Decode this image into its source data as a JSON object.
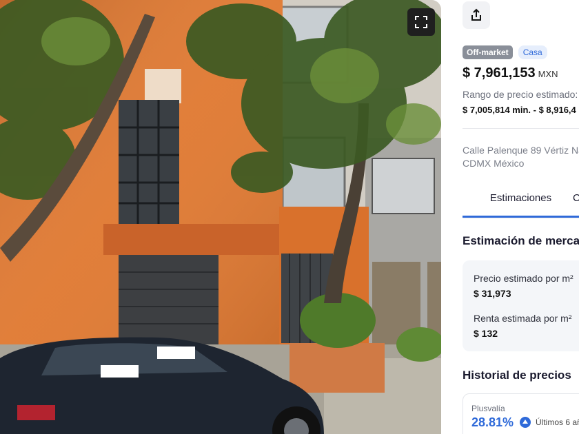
{
  "photo": {
    "alt_icons": [
      "expand-icon"
    ]
  },
  "listing": {
    "status_badge": "Off-market",
    "type_badge": "Casa",
    "price": "$ 7,961,153",
    "currency": "MXN",
    "range_label": "Rango de precio estimado:",
    "range_value": "$ 7,005,814 min. - $ 8,916,4",
    "address_line1": "Calle Palenque 89 Vértiz Na",
    "address_line2": "CDMX México"
  },
  "tabs": [
    {
      "label": "Estimaciones",
      "active": true
    },
    {
      "label": "C",
      "active": false
    }
  ],
  "market": {
    "heading": "Estimación de merca",
    "price_m2_label": "Precio estimado por m²",
    "price_m2_value": "$ 31,973",
    "rent_m2_label": "Renta estimada por m²",
    "rent_m2_value": "$ 132"
  },
  "history": {
    "heading": "Historial de precios",
    "plusvalia_label": "Plusvalía",
    "plusvalia_value": "28.81%",
    "period": "Últimos 6 añ"
  },
  "colors": {
    "accent": "#2f6ad9",
    "facade": "#e07a33",
    "badge_gray": "#8a8f99"
  },
  "icons": [
    "share-icon",
    "expand-icon",
    "arrow-up-icon"
  ]
}
